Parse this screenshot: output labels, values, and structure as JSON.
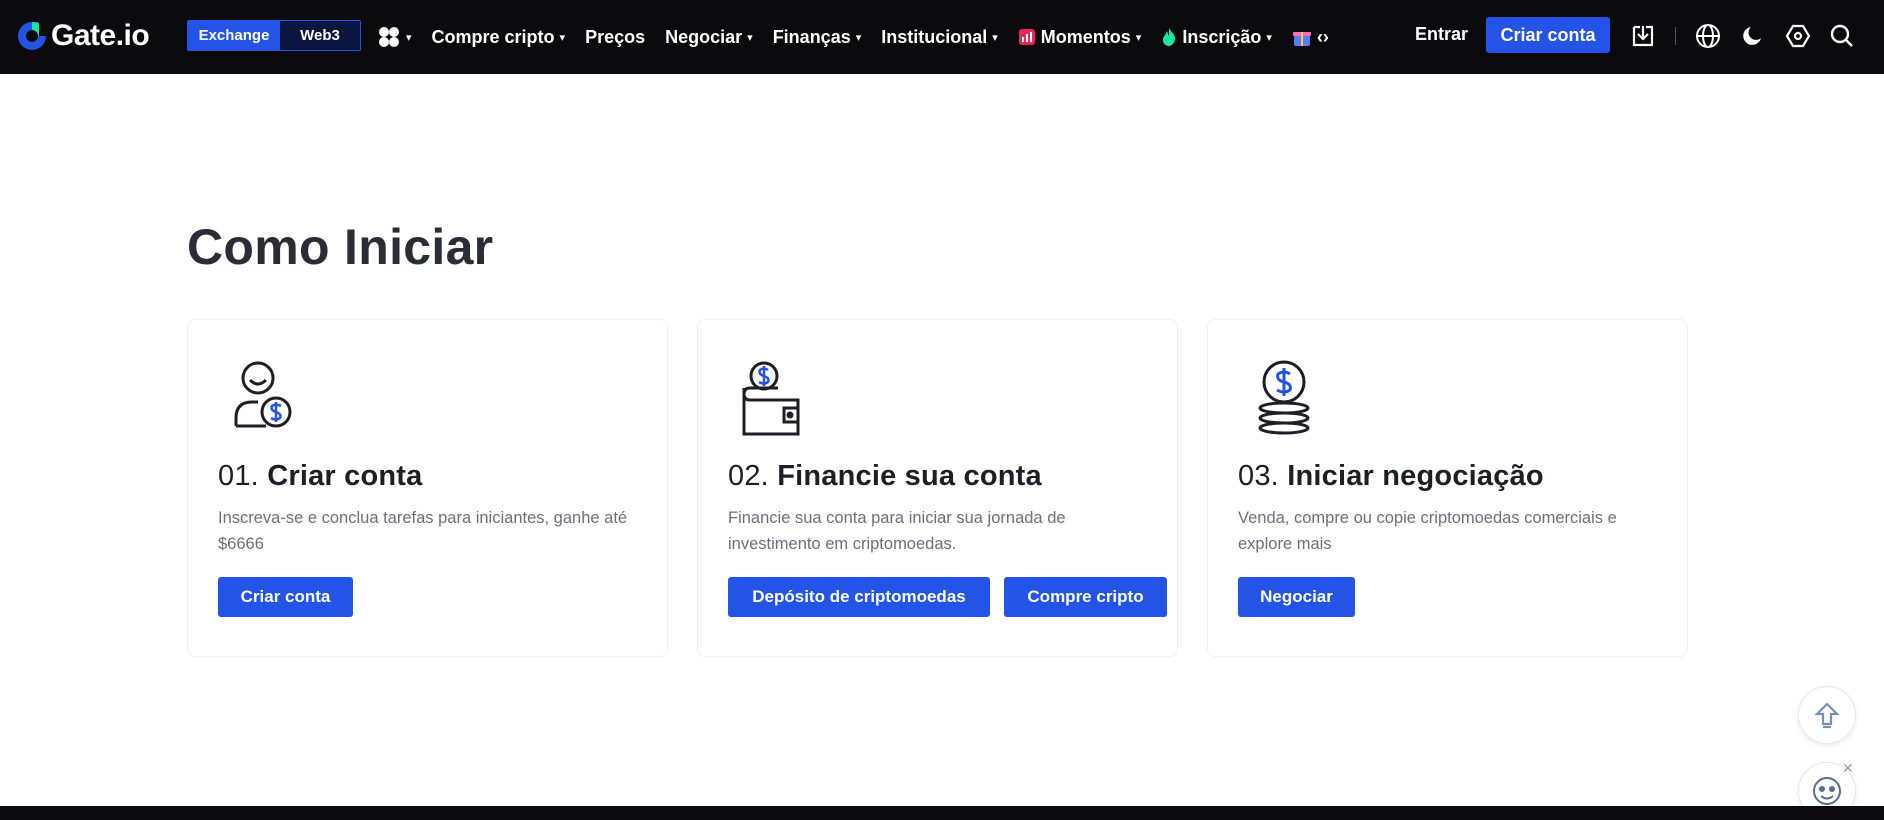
{
  "brand": {
    "name": "Gate.io",
    "accent": "#2354e6"
  },
  "header": {
    "switch": {
      "exchange": "Exchange",
      "web3": "Web3"
    },
    "menu": [
      {
        "label": "Compre cripto",
        "caret": "▾"
      },
      {
        "label": "Preços"
      },
      {
        "label": "Negociar",
        "caret": "▾"
      },
      {
        "label": "Finanças",
        "caret": "▾"
      },
      {
        "label": "Institucional",
        "caret": "▾"
      },
      {
        "label": "Momentos",
        "caret": "▾",
        "icon": "chart-icon"
      },
      {
        "label": "Inscrição",
        "caret": "▾",
        "icon": "flame-icon"
      }
    ],
    "apps_caret": "▾",
    "more_glyph": "‹›",
    "login": "Entrar",
    "signup": "Criar conta"
  },
  "main": {
    "title": "Como Iniciar",
    "steps": [
      {
        "number": "01.",
        "title": "Criar conta",
        "desc": "Inscreva-se e conclua tarefas para iniciantes, ganhe até $6666",
        "buttons": [
          "Criar conta"
        ],
        "icon": "user-coin-icon"
      },
      {
        "number": "02.",
        "title": "Financie sua conta",
        "desc": "Financie sua conta para iniciar sua jornada de investimento em criptomoedas.",
        "buttons": [
          "Depósito de criptomoedas",
          "Compre cripto"
        ],
        "icon": "wallet-coin-icon"
      },
      {
        "number": "03.",
        "title": "Iniciar negociação",
        "desc": "Venda, compre ou copie criptomoedas comerciais e explore mais",
        "buttons": [
          "Negociar"
        ],
        "icon": "coin-stack-icon"
      }
    ]
  },
  "floating": {
    "close": "✕"
  }
}
